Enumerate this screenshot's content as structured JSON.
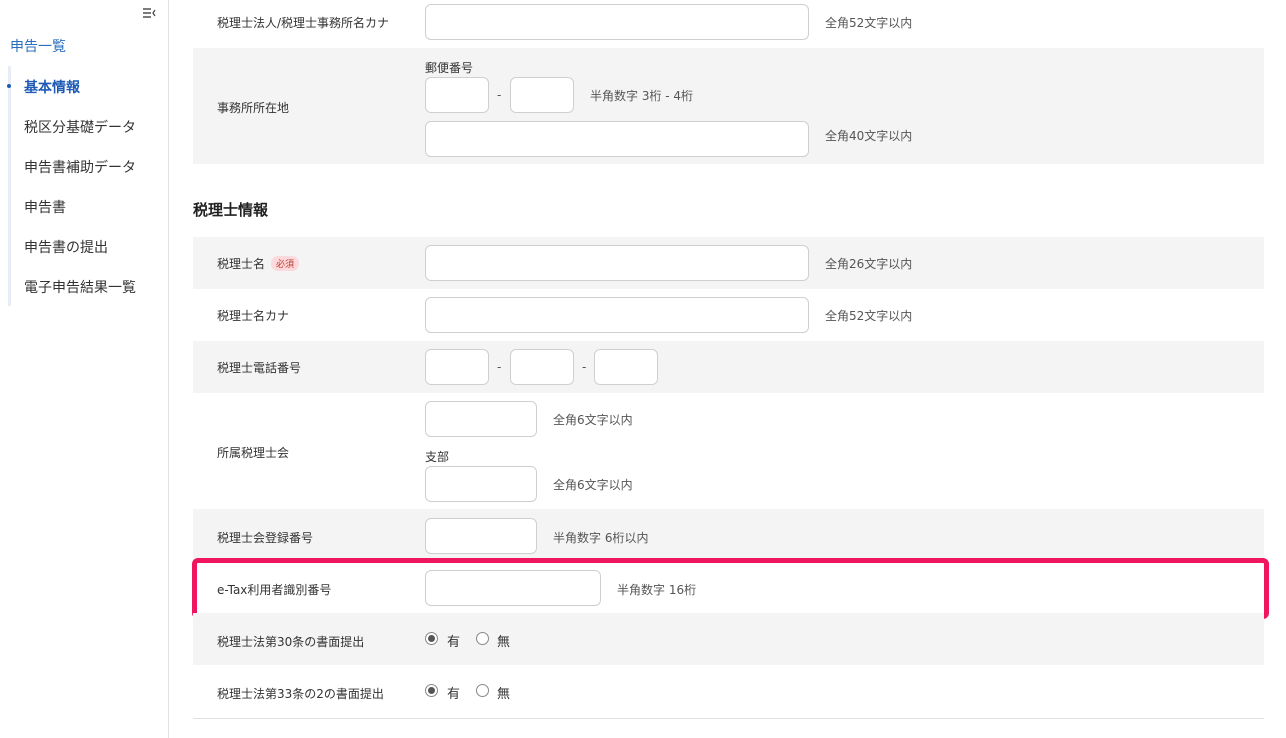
{
  "sidebar": {
    "title": "申告一覧",
    "items": [
      {
        "label": "基本情報",
        "active": true
      },
      {
        "label": "税区分基礎データ"
      },
      {
        "label": "申告書補助データ"
      },
      {
        "label": "申告書"
      },
      {
        "label": "申告書の提出"
      },
      {
        "label": "電子申告結果一覧"
      }
    ]
  },
  "office": {
    "kana_label": "税理士法人/税理士事務所名カナ",
    "kana_hint": "全角52文字以内",
    "address_label": "事務所所在地",
    "postal_label": "郵便番号",
    "postal_dash": "-",
    "postal_hint": "半角数字 3桁 - 4桁",
    "address_hint": "全角40文字以内"
  },
  "accountant": {
    "section_title": "税理士情報",
    "name_label": "税理士名",
    "required_badge": "必須",
    "name_hint": "全角26文字以内",
    "kana_label": "税理士名カナ",
    "kana_hint": "全角52文字以内",
    "phone_label": "税理士電話番号",
    "phone_dash1": "-",
    "phone_dash2": "-",
    "assoc_label": "所属税理士会",
    "assoc_hint": "全角6文字以内",
    "branch_label": "支部",
    "branch_hint": "全角6文字以内",
    "reg_label": "税理士会登録番号",
    "reg_hint": "半角数字 6桁以内",
    "etax_label": "e-Tax利用者識別番号",
    "etax_hint": "半角数字 16桁",
    "art30_label": "税理士法第30条の書面提出",
    "art30_yes": "有",
    "art30_no": "無",
    "art33_label": "税理士法第33条の2の書面提出",
    "art33_yes": "有",
    "art33_no": "無"
  },
  "colors": {
    "accent": "#1f5bb5",
    "highlight": "#f0155f",
    "row_gray": "#f4f4f4"
  }
}
